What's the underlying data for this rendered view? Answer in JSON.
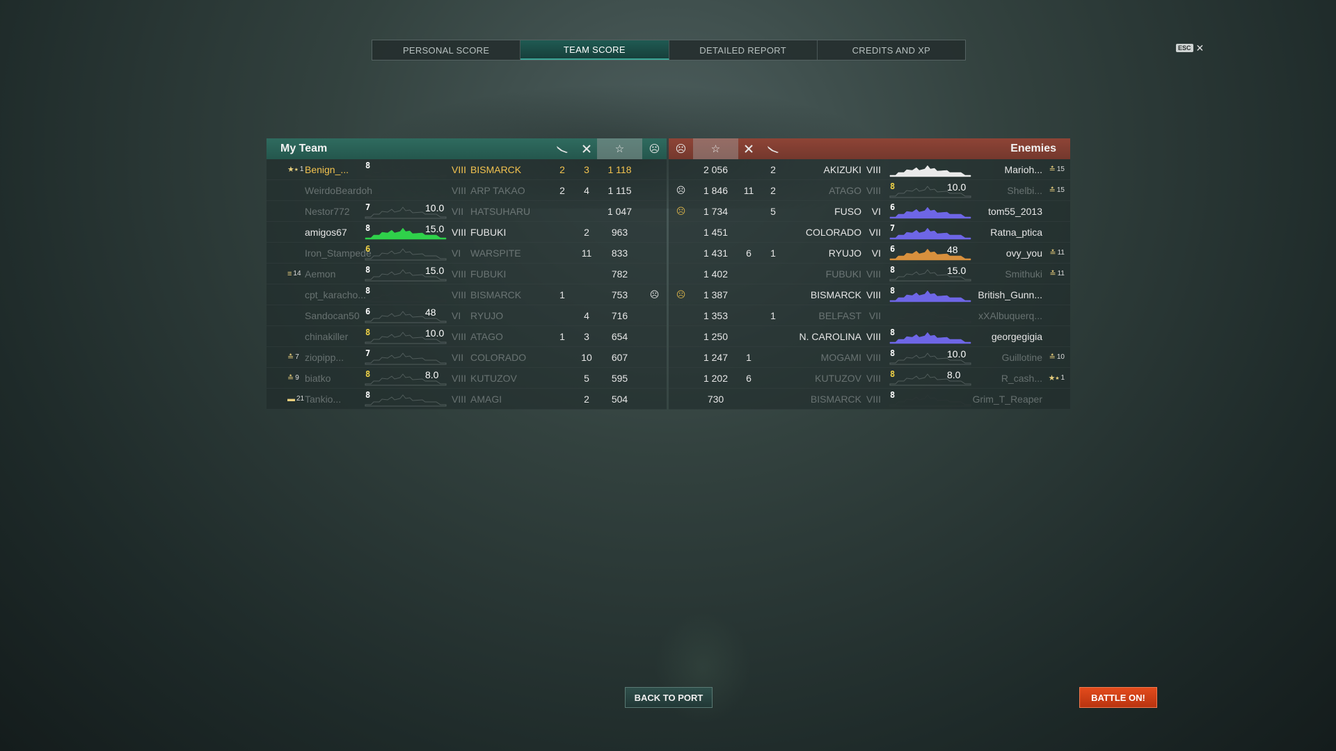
{
  "tabs": [
    {
      "label": "PERSONAL SCORE",
      "active": false
    },
    {
      "label": "TEAM SCORE",
      "active": true
    },
    {
      "label": "DETAILED REPORT",
      "active": false
    },
    {
      "label": "CREDITS AND XP",
      "active": false
    }
  ],
  "esc": {
    "key": "ESC",
    "close": "✕"
  },
  "my_team": {
    "title": "My Team",
    "columns": {
      "planes_icon": "plane-icon",
      "kills_icon": "crossed-swords-icon",
      "score_icon": "star-icon",
      "status_icon": "skull-icon"
    },
    "players": [
      {
        "rank_icon": "★⭑",
        "rank": "1",
        "name": "Benign_...",
        "tier_badge": "8",
        "ship_tier": "VIII",
        "ship": "BISMARCK",
        "planes": "2",
        "kills": "3",
        "score": "1 118",
        "status": "",
        "rating": "",
        "state": "me",
        "graph": "dark"
      },
      {
        "rank_icon": "",
        "rank": "",
        "name": "WeirdoBeardoh",
        "tier_badge": "",
        "ship_tier": "VIII",
        "ship": "ARP TAKAO",
        "planes": "2",
        "kills": "4",
        "score": "1 115",
        "status": "",
        "rating": "",
        "state": "dim",
        "graph": "dark"
      },
      {
        "rank_icon": "",
        "rank": "",
        "name": "Nestor772",
        "tier_badge": "7",
        "ship_tier": "VII",
        "ship": "HATSUHARU",
        "planes": "",
        "kills": "",
        "score": "1 047",
        "status": "",
        "rating": "10.0",
        "state": "dim",
        "graph": "grey"
      },
      {
        "rank_icon": "",
        "rank": "",
        "name": "amigos67",
        "tier_badge": "8",
        "ship_tier": "VIII",
        "ship": "FUBUKI",
        "planes": "",
        "kills": "2",
        "score": "963",
        "status": "",
        "rating": "15.0",
        "state": "alive",
        "graph": "green"
      },
      {
        "rank_icon": "",
        "rank": "",
        "name": "Iron_Stampede",
        "tier_badge": "6",
        "ship_tier": "VI",
        "ship": "WARSPITE",
        "planes": "",
        "kills": "11",
        "score": "833",
        "status": "",
        "rating": "",
        "state": "dim",
        "graph": "grey",
        "badge_gold": true
      },
      {
        "rank_icon": "≡",
        "rank": "14",
        "name": "Aemon",
        "tier_badge": "8",
        "ship_tier": "VIII",
        "ship": "FUBUKI",
        "planes": "",
        "kills": "",
        "score": "782",
        "status": "",
        "rating": "15.0",
        "state": "dim",
        "graph": "grey"
      },
      {
        "rank_icon": "",
        "rank": "",
        "name": "cpt_karacho...",
        "tier_badge": "8",
        "ship_tier": "VIII",
        "ship": "BISMARCK",
        "planes": "1",
        "kills": "",
        "score": "753",
        "status": "☹",
        "rating": "",
        "state": "dim",
        "graph": "dark"
      },
      {
        "rank_icon": "",
        "rank": "",
        "name": "Sandocan50",
        "tier_badge": "6",
        "ship_tier": "VI",
        "ship": "RYUJO",
        "planes": "",
        "kills": "4",
        "score": "716",
        "status": "",
        "rating": "48",
        "state": "dim",
        "graph": "grey"
      },
      {
        "rank_icon": "",
        "rank": "",
        "name": "chinakiller",
        "tier_badge": "8",
        "ship_tier": "VIII",
        "ship": "ATAGO",
        "planes": "1",
        "kills": "3",
        "score": "654",
        "status": "",
        "rating": "10.0",
        "state": "dim",
        "graph": "grey",
        "badge_gold": true
      },
      {
        "rank_icon": "≛",
        "rank": "7",
        "name": "ziopipp...",
        "tier_badge": "7",
        "ship_tier": "VII",
        "ship": "COLORADO",
        "planes": "",
        "kills": "10",
        "score": "607",
        "status": "",
        "rating": "",
        "state": "dim",
        "graph": "grey"
      },
      {
        "rank_icon": "≛",
        "rank": "9",
        "name": "biatko",
        "tier_badge": "8",
        "ship_tier": "VIII",
        "ship": "KUTUZOV",
        "planes": "",
        "kills": "5",
        "score": "595",
        "status": "",
        "rating": "8.0",
        "state": "dim",
        "graph": "grey",
        "badge_gold": true
      },
      {
        "rank_icon": "▬",
        "rank": "21",
        "name": "Tankio...",
        "tier_badge": "8",
        "ship_tier": "VIII",
        "ship": "AMAGI",
        "planes": "",
        "kills": "2",
        "score": "504",
        "status": "",
        "rating": "",
        "state": "dim",
        "graph": "grey"
      }
    ]
  },
  "enemies": {
    "title": "Enemies",
    "players": [
      {
        "status": "",
        "score": "2 056",
        "kills": "",
        "planes": "2",
        "ship": "AKIZUKI",
        "ship_tier": "VIII",
        "tier_badge": "",
        "rating": "",
        "name": "Marioh...",
        "rank_icon": "≛",
        "rank": "15",
        "state": "alive",
        "graph": "white"
      },
      {
        "status": "☹",
        "score": "1 846",
        "kills": "11",
        "planes": "2",
        "ship": "ATAGO",
        "ship_tier": "VIII",
        "tier_badge": "8",
        "rating": "10.0",
        "name": "Shelbi...",
        "rank_icon": "≛",
        "rank": "15",
        "state": "dim",
        "graph": "grey",
        "badge_gold": true
      },
      {
        "status": "☹",
        "score": "1 734",
        "kills": "",
        "planes": "5",
        "ship": "FUSO",
        "ship_tier": "VI",
        "tier_badge": "6",
        "rating": "",
        "name": "tom55_2013",
        "rank_icon": "",
        "rank": "",
        "state": "alive",
        "graph": "purple"
      },
      {
        "status": "",
        "score": "1 451",
        "kills": "",
        "planes": "",
        "ship": "COLORADO",
        "ship_tier": "VII",
        "tier_badge": "7",
        "rating": "",
        "name": "Ratna_ptica",
        "rank_icon": "",
        "rank": "",
        "state": "alive",
        "graph": "purple"
      },
      {
        "status": "",
        "score": "1 431",
        "kills": "6",
        "planes": "1",
        "ship": "RYUJO",
        "ship_tier": "VI",
        "tier_badge": "6",
        "rating": "48",
        "name": "ovy_you",
        "rank_icon": "≛",
        "rank": "11",
        "state": "alive",
        "graph": "orange"
      },
      {
        "status": "",
        "score": "1 402",
        "kills": "",
        "planes": "",
        "ship": "FUBUKI",
        "ship_tier": "VIII",
        "tier_badge": "8",
        "rating": "15.0",
        "name": "Smithuki",
        "rank_icon": "≛",
        "rank": "11",
        "state": "dim",
        "graph": "grey"
      },
      {
        "status": "☹",
        "score": "1 387",
        "kills": "",
        "planes": "",
        "ship": "BISMARCK",
        "ship_tier": "VIII",
        "tier_badge": "8",
        "rating": "",
        "name": "British_Gunn...",
        "rank_icon": "",
        "rank": "",
        "state": "alive",
        "graph": "purple"
      },
      {
        "status": "",
        "score": "1 353",
        "kills": "",
        "planes": "1",
        "ship": "BELFAST",
        "ship_tier": "VII",
        "tier_badge": "",
        "rating": "",
        "name": "xXAlbuquerq...",
        "rank_icon": "",
        "rank": "",
        "state": "dim",
        "graph": "dark"
      },
      {
        "status": "",
        "score": "1 250",
        "kills": "",
        "planes": "",
        "ship": "N. CAROLINA",
        "ship_tier": "VIII",
        "tier_badge": "8",
        "rating": "",
        "name": "georgegigia",
        "rank_icon": "",
        "rank": "",
        "state": "alive",
        "graph": "purple"
      },
      {
        "status": "",
        "score": "1 247",
        "kills": "1",
        "planes": "",
        "ship": "MOGAMI",
        "ship_tier": "VIII",
        "tier_badge": "8",
        "rating": "10.0",
        "name": "Guillotine",
        "rank_icon": "≛",
        "rank": "10",
        "state": "dim",
        "graph": "grey"
      },
      {
        "status": "",
        "score": "1 202",
        "kills": "6",
        "planes": "",
        "ship": "KUTUZOV",
        "ship_tier": "VIII",
        "tier_badge": "8",
        "rating": "8.0",
        "name": "R_cash...",
        "rank_icon": "★⭑",
        "rank": "1",
        "state": "dim",
        "graph": "grey",
        "badge_gold": true
      },
      {
        "status": "",
        "score": "730",
        "kills": "",
        "planes": "",
        "ship": "BISMARCK",
        "ship_tier": "VIII",
        "tier_badge": "8",
        "rating": "",
        "name": "Grim_T_Reaper",
        "rank_icon": "",
        "rank": "",
        "state": "dim",
        "graph": "dark"
      }
    ]
  },
  "buttons": {
    "back": "BACK TO PORT",
    "battle": "BATTLE ON!"
  },
  "colors": {
    "my_team_header": "#2f6b5f",
    "enemy_header": "#8e4436",
    "me": "#f2c24f",
    "battle_button": "#e34b1c"
  }
}
